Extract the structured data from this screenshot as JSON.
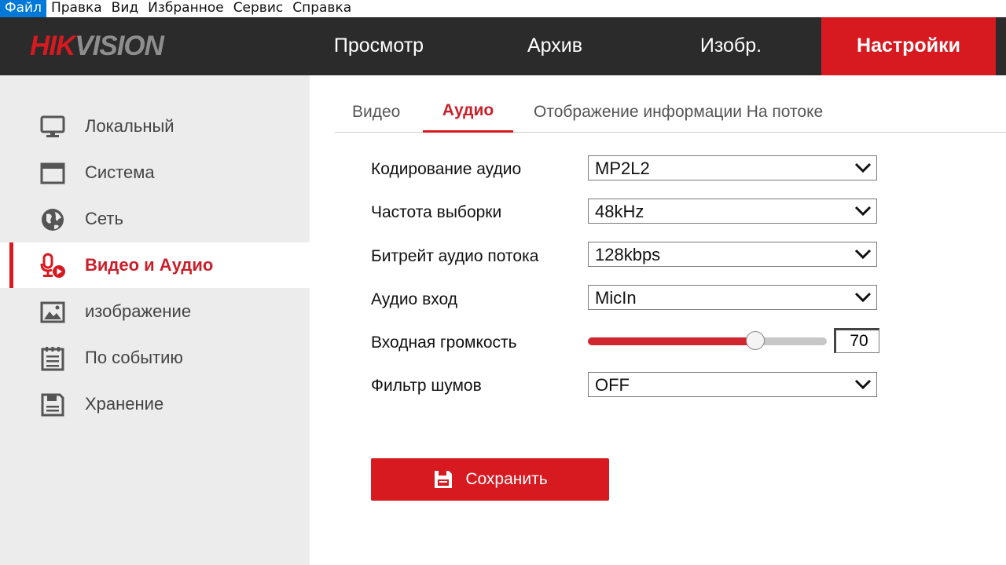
{
  "menubar": {
    "items": [
      "Файл",
      "Правка",
      "Вид",
      "Избранное",
      "Сервис",
      "Справка"
    ]
  },
  "header": {
    "logo_part1": "HIK",
    "logo_part2": "VISION",
    "tabs": [
      "Просмотр",
      "Архив",
      "Изобр.",
      "Настройки"
    ],
    "active_tab": "Настройки"
  },
  "sidebar": {
    "items": [
      {
        "label": "Локальный",
        "icon": "monitor-icon"
      },
      {
        "label": "Система",
        "icon": "window-icon"
      },
      {
        "label": "Сеть",
        "icon": "globe-icon"
      },
      {
        "label": "Видео и Аудио",
        "icon": "microphone-play-icon"
      },
      {
        "label": "изображение",
        "icon": "image-icon"
      },
      {
        "label": "По событию",
        "icon": "calendar-list-icon"
      },
      {
        "label": "Хранение",
        "icon": "floppy-icon"
      }
    ],
    "active_item": "Видео и Аудио"
  },
  "subtabs": {
    "items": [
      "Видео",
      "Аудио",
      "Отображение информации На потоке"
    ],
    "active": "Аудио"
  },
  "form": {
    "audio_encoding": {
      "label": "Кодирование аудио",
      "value": "MP2L2"
    },
    "sample_rate": {
      "label": "Частота выборки",
      "value": "48kHz"
    },
    "bitrate": {
      "label": "Битрейт аудио потока",
      "value": "128kbps"
    },
    "audio_input": {
      "label": "Аудио вход",
      "value": "MicIn"
    },
    "input_volume": {
      "label": "Входная громкость",
      "value": "70",
      "level_percent": 70
    },
    "noise_filter": {
      "label": "Фильтр шумов",
      "value": "OFF"
    }
  },
  "save_button": {
    "label": "Сохранить",
    "icon": "floppy-icon"
  },
  "colors": {
    "accent": "#d71920",
    "header_bg": "#2b2b2b",
    "sidebar_bg": "#ececec"
  }
}
